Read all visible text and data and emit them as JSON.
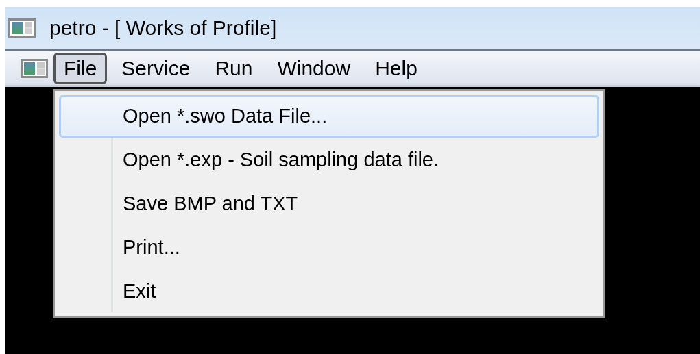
{
  "window": {
    "title": "petro - [ Works of Profile]"
  },
  "menu_bar": [
    {
      "label": "File",
      "selected": true
    },
    {
      "label": "Service",
      "selected": false
    },
    {
      "label": "Run",
      "selected": false
    },
    {
      "label": "Window",
      "selected": false
    },
    {
      "label": "Help",
      "selected": false
    }
  ],
  "file_menu": [
    {
      "label": "Open *.swo Data File...",
      "selected": true
    },
    {
      "label": "Open *.exp - Soil sampling data file.",
      "selected": false
    },
    {
      "label": "Save BMP and TXT",
      "selected": false
    },
    {
      "label": "Print...",
      "selected": false
    },
    {
      "label": "Exit",
      "selected": false
    }
  ]
}
